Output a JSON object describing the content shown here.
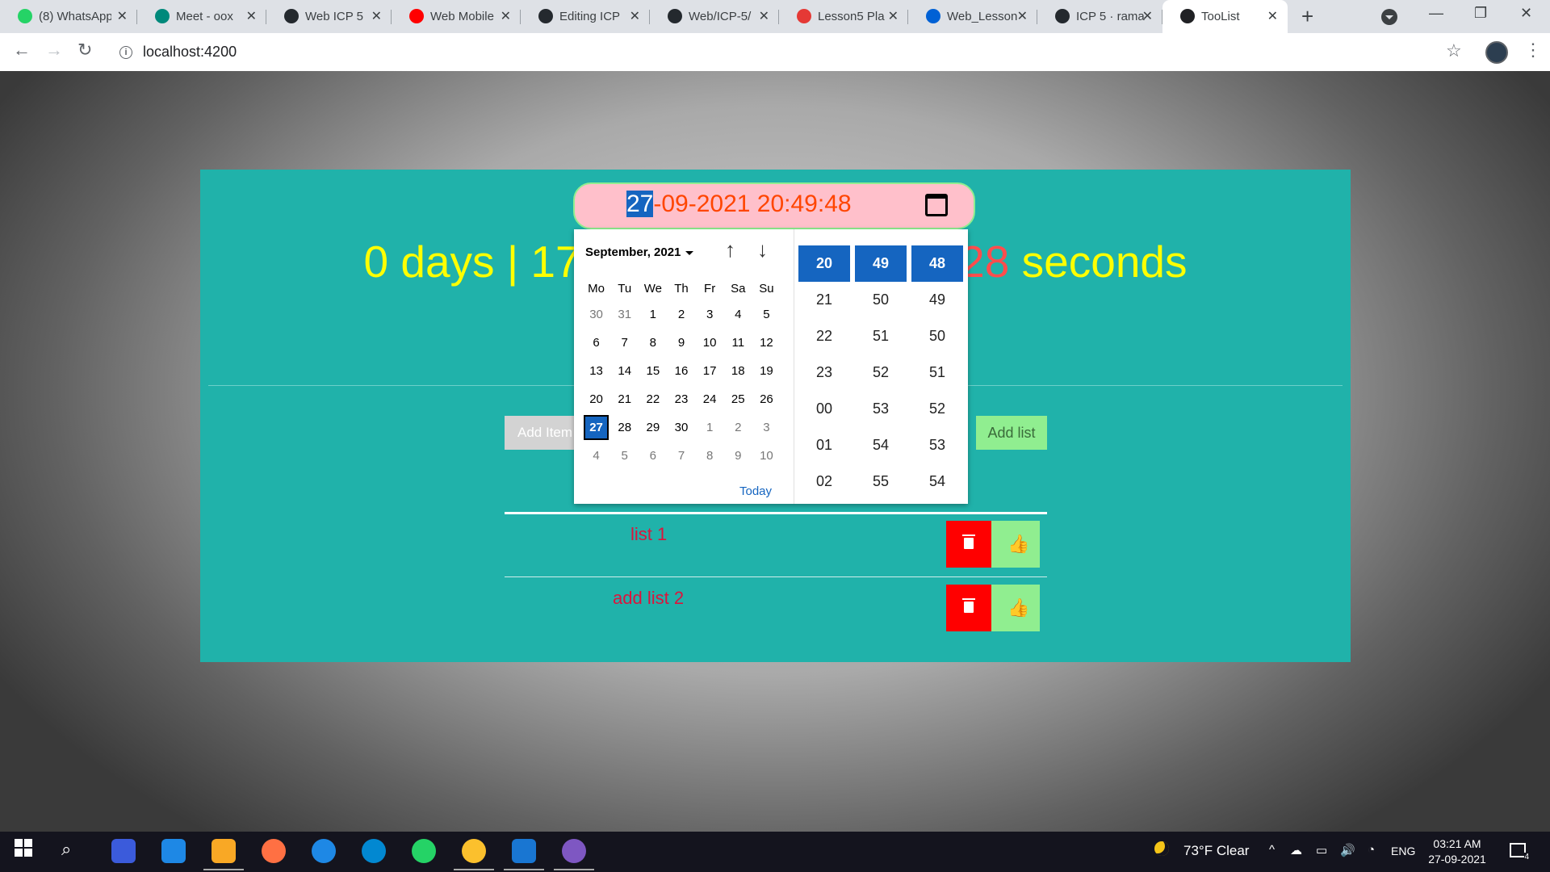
{
  "browser": {
    "tabs": [
      {
        "title": "(8) WhatsApp",
        "icon": "whatsapp-icon",
        "color": "#25d366"
      },
      {
        "title": "Meet - oox",
        "icon": "meet-icon",
        "color": "#00897b"
      },
      {
        "title": "Web ICP 5",
        "icon": "github-icon",
        "color": "#24292e"
      },
      {
        "title": "Web Mobile",
        "icon": "youtube-icon",
        "color": "#ff0000"
      },
      {
        "title": "Editing ICP",
        "icon": "github-icon",
        "color": "#24292e"
      },
      {
        "title": "Web/ICP-5/",
        "icon": "github-icon",
        "color": "#24292e"
      },
      {
        "title": "Lesson5 Pla",
        "icon": "lesson-icon",
        "color": "#e53935"
      },
      {
        "title": "Web_Lesson",
        "icon": "box-icon",
        "color": "#0061d5"
      },
      {
        "title": "ICP 5 · rama",
        "icon": "github-icon",
        "color": "#24292e"
      },
      {
        "title": "TooList",
        "icon": "angular-icon",
        "color": "#202124",
        "active": true
      }
    ],
    "url": "localhost:4200"
  },
  "countdown": {
    "days": "0",
    "days_label": "days",
    "separator": "|",
    "hours": "17",
    "seconds": "28",
    "seconds_label": "seconds"
  },
  "date_input": {
    "day": "27",
    "rest": "-09-2021 20:49:48"
  },
  "picker": {
    "month_title": "September, 2021",
    "weekdays": [
      "Mo",
      "Tu",
      "We",
      "Th",
      "Fr",
      "Sa",
      "Su"
    ],
    "weeks": [
      [
        "30",
        "31",
        "1",
        "2",
        "3",
        "4",
        "5"
      ],
      [
        "6",
        "7",
        "8",
        "9",
        "10",
        "11",
        "12"
      ],
      [
        "13",
        "14",
        "15",
        "16",
        "17",
        "18",
        "19"
      ],
      [
        "20",
        "21",
        "22",
        "23",
        "24",
        "25",
        "26"
      ],
      [
        "27",
        "28",
        "29",
        "30",
        "1",
        "2",
        "3"
      ],
      [
        "4",
        "5",
        "6",
        "7",
        "8",
        "9",
        "10"
      ]
    ],
    "selected_day": "27",
    "today_label": "Today",
    "hours": [
      "20",
      "21",
      "22",
      "23",
      "00",
      "01",
      "02"
    ],
    "minutes": [
      "49",
      "50",
      "51",
      "52",
      "53",
      "54",
      "55"
    ],
    "seconds": [
      "48",
      "49",
      "50",
      "51",
      "52",
      "53",
      "54"
    ]
  },
  "todo": {
    "input_placeholder": "Add Item",
    "add_button": "Add list",
    "items": [
      "list 1",
      "add list 2"
    ]
  },
  "taskbar": {
    "weather": "73°F  Clear",
    "language": "ENG",
    "time": "03:21 AM",
    "date": "27-09-2021",
    "notifications": "4"
  }
}
